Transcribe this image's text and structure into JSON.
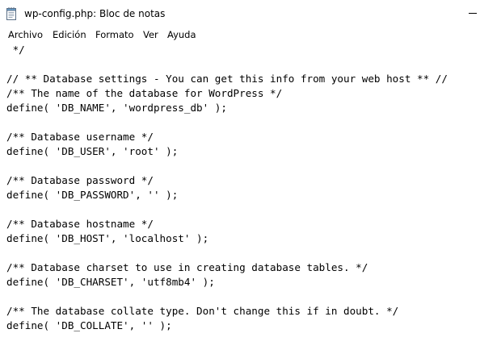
{
  "window": {
    "title": "wp-config.php: Bloc de notas",
    "app_icon": "notepad-icon"
  },
  "menu": {
    "items": [
      {
        "label": "Archivo"
      },
      {
        "label": "Edición"
      },
      {
        "label": "Formato"
      },
      {
        "label": "Ver"
      },
      {
        "label": "Ayuda"
      }
    ]
  },
  "editor": {
    "lines": [
      " */",
      "",
      "// ** Database settings - You can get this info from your web host ** //",
      "/** The name of the database for WordPress */",
      "define( 'DB_NAME', 'wordpress_db' );",
      "",
      "/** Database username */",
      "define( 'DB_USER', 'root' );",
      "",
      "/** Database password */",
      "define( 'DB_PASSWORD', '' );",
      "",
      "/** Database hostname */",
      "define( 'DB_HOST', 'localhost' );",
      "",
      "/** Database charset to use in creating database tables. */",
      "define( 'DB_CHARSET', 'utf8mb4' );",
      "",
      "/** The database collate type. Don't change this if in doubt. */",
      "define( 'DB_COLLATE', '' );"
    ]
  }
}
